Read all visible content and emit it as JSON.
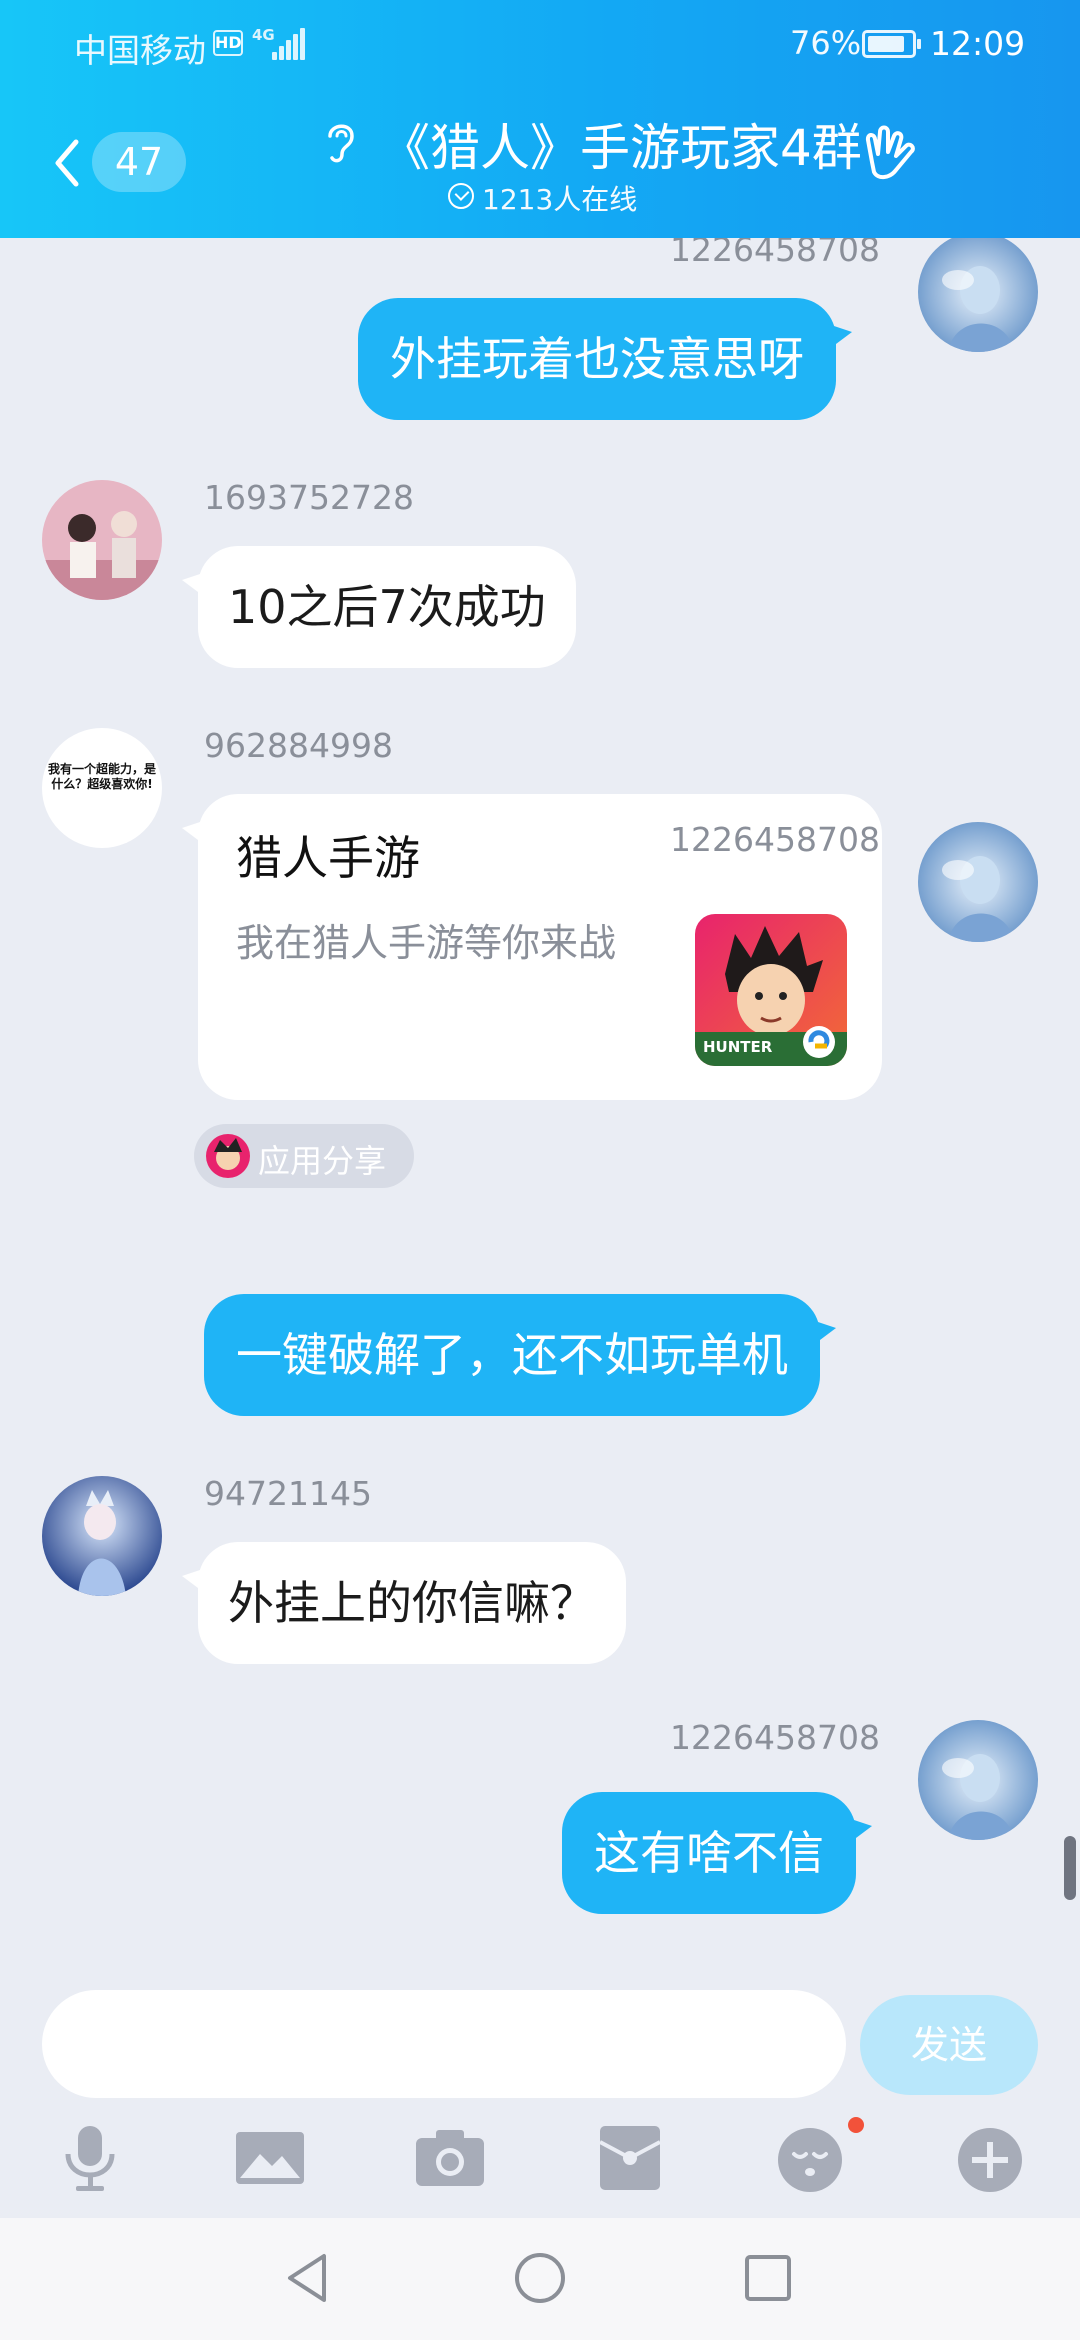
{
  "status_bar": {
    "carrier": "中国移动",
    "hd_badge": "HD",
    "network": "4G",
    "battery_percent": "76%",
    "time": "12:09"
  },
  "header": {
    "unread_count": "47",
    "title": "《猎人》手游玩家4群",
    "online_status": "1213人在线"
  },
  "messages": [
    {
      "sender": "1226458708",
      "side": "right",
      "text": "外挂玩着也没意思呀"
    },
    {
      "sender": "1693752728",
      "side": "left",
      "text": "10之后7次成功"
    },
    {
      "sender": "962884998",
      "side": "left",
      "type": "app_card",
      "avatar_text": "我有一个超能力，是什么？超级喜欢你!",
      "card_title": "猎人手游",
      "card_desc": "我在猎人手游等你来战",
      "card_icon_text": "HUNTER",
      "share_label": "应用分享"
    },
    {
      "sender": "1226458708",
      "side": "right",
      "text": "一键破解了，还不如玩单机"
    },
    {
      "sender": "94721145",
      "side": "left",
      "text": "外挂上的你信嘛？"
    },
    {
      "sender": "1226458708",
      "side": "right",
      "text": "这有啥不信"
    }
  ],
  "input": {
    "value": "",
    "send_label": "发送"
  },
  "toolbar": [
    "microphone-icon",
    "image-icon",
    "camera-icon",
    "red-packet-icon",
    "emoji-icon",
    "plus-icon"
  ],
  "colors": {
    "header": "#13a9f4",
    "my_bubble": "#1fb4f6",
    "chat_background": "#eaedf4",
    "send_button": "#b8e7fb"
  }
}
